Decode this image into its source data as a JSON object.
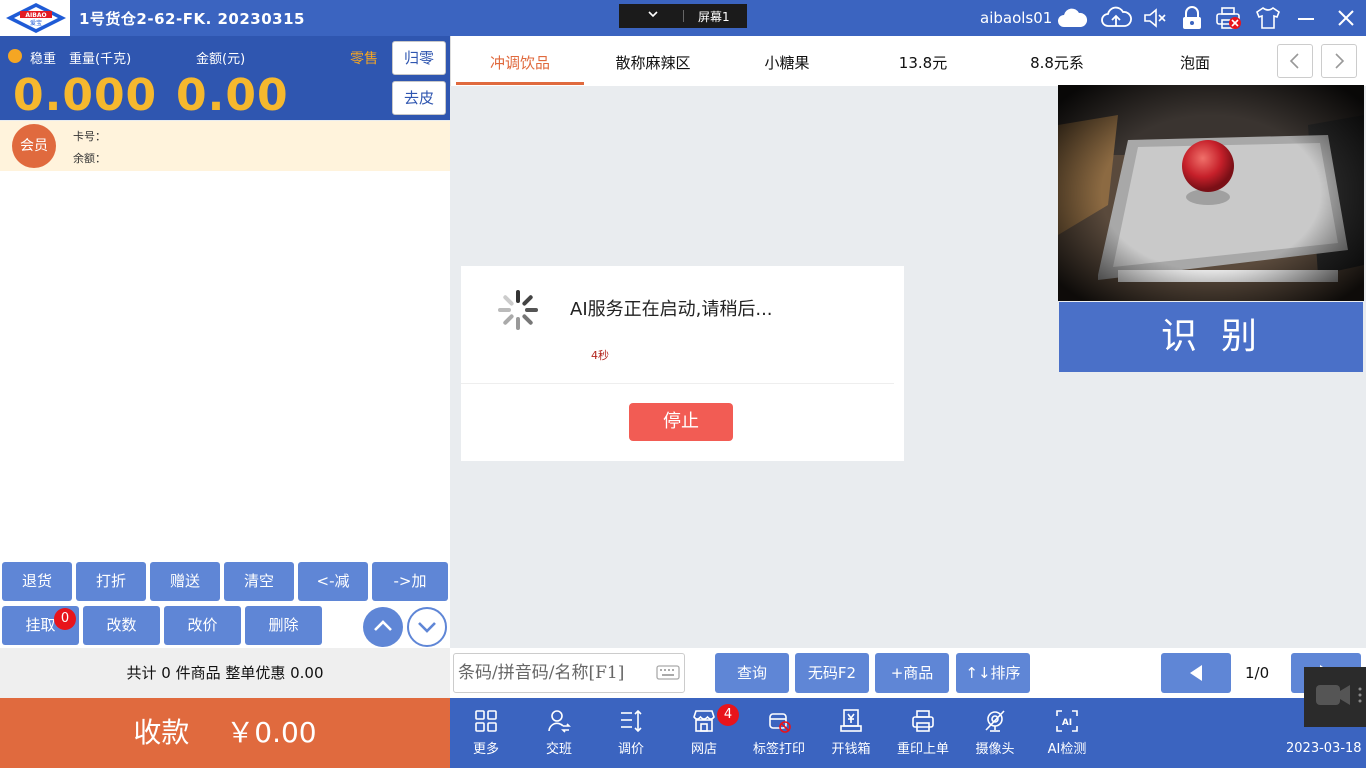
{
  "titlebar": {
    "logo_text": "AIBAO",
    "logo_subtext": "爱宝",
    "app_title": "1号货仓2-62-FK. 20230315",
    "screen_selector": "屏幕1",
    "username": "aibaols01"
  },
  "scale": {
    "stable_label": "稳重",
    "weight_label": "重量(千克)",
    "amount_label": "金额(元)",
    "mode_label": "零售",
    "weight_value": "0.000",
    "amount_value": "0.00",
    "zero_button": "归零",
    "tare_button": "去皮"
  },
  "member": {
    "badge": "会员",
    "card_label": "卡号：",
    "balance_label": "余额："
  },
  "cart_actions": {
    "return": "退货",
    "discount": "打折",
    "gift": "赠送",
    "clear": "清空",
    "decrease": "<-减",
    "increase": "->加",
    "hold": "挂取",
    "hold_count": "0",
    "change_qty": "改数",
    "change_price": "改价",
    "delete": "删除"
  },
  "summary": {
    "text": "共计 0 件商品 整单优惠 0.00"
  },
  "payment": {
    "label": "收款",
    "amount": "￥0.00"
  },
  "tabs": [
    {
      "label": "冲调饮品",
      "active": true
    },
    {
      "label": "散称麻辣区"
    },
    {
      "label": "小糖果"
    },
    {
      "label": "13.8元"
    },
    {
      "label": "8.8元系"
    },
    {
      "label": "泡面"
    }
  ],
  "camera": {
    "identify_button": "识别"
  },
  "dialog": {
    "message": "AI服务正在启动,请稍后...",
    "countdown": "4秒",
    "stop_button": "停止"
  },
  "search": {
    "placeholder": "条码/拼音码/名称[F1]",
    "query_button": "查询",
    "nocode_button": "无码F2",
    "add_product_button": "+商品",
    "sort_button": "↑↓排序",
    "page_indicator": "1/0"
  },
  "toolbar": {
    "more": "更多",
    "shift": "交班",
    "price_adjust": "调价",
    "web_store": "网店",
    "web_store_count": "4",
    "label_print": "标签打印",
    "cash_drawer": "开钱箱",
    "reprint": "重印上单",
    "camera": "摄像头",
    "ai_detect": "AI检测",
    "ai_icon_text": "AI",
    "date": "2023-03-18"
  },
  "colors": {
    "primary_blue": "#3b64c0",
    "button_blue": "#5f86d6",
    "accent_orange": "#e06a3e",
    "weight_yellow": "#f5b82e",
    "stop_red": "#f25c54"
  },
  "icons": [
    "cloud-icon",
    "cloud-upload-icon",
    "speaker-muted-icon",
    "lock-icon",
    "printer-error-icon",
    "shirt-icon",
    "minimize-icon",
    "close-icon"
  ]
}
